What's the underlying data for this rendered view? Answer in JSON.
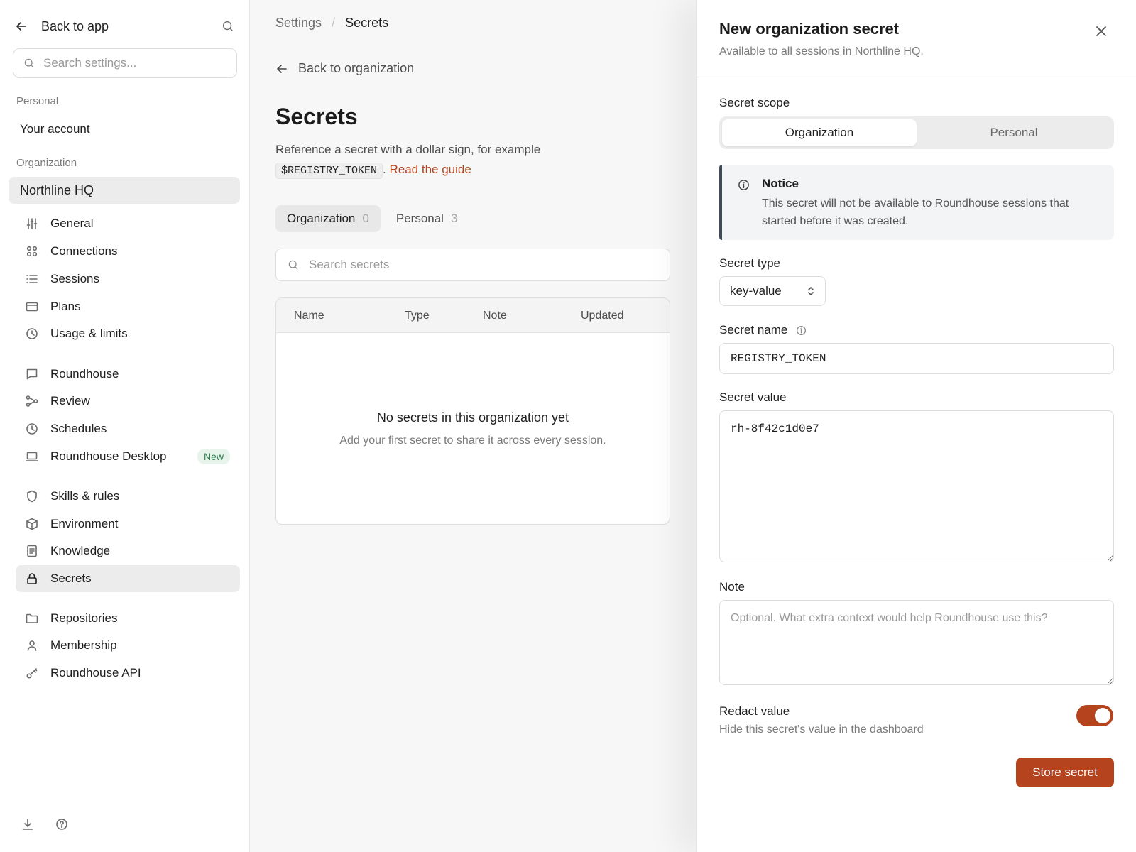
{
  "sidebar": {
    "back_label": "Back to app",
    "search_placeholder": "Search settings...",
    "personal_label": "Personal",
    "account_label": "Your account",
    "organization_label": "Organization",
    "org_name": "Northline HQ",
    "items": [
      {
        "label": "General",
        "icon": "sliders-icon"
      },
      {
        "label": "Connections",
        "icon": "grid-icon"
      },
      {
        "label": "Sessions",
        "icon": "list-icon"
      },
      {
        "label": "Plans",
        "icon": "card-icon"
      },
      {
        "label": "Usage & limits",
        "icon": "clock-icon"
      },
      {
        "label": "Roundhouse",
        "icon": "chat-icon"
      },
      {
        "label": "Review",
        "icon": "branch-icon"
      },
      {
        "label": "Schedules",
        "icon": "clock-icon"
      },
      {
        "label": "Roundhouse Desktop",
        "icon": "laptop-icon",
        "badge": "New"
      },
      {
        "label": "Skills & rules",
        "icon": "shield-icon"
      },
      {
        "label": "Environment",
        "icon": "cube-icon"
      },
      {
        "label": "Knowledge",
        "icon": "document-icon"
      },
      {
        "label": "Secrets",
        "icon": "lock-icon",
        "selected": true
      },
      {
        "label": "Repositories",
        "icon": "folder-icon"
      },
      {
        "label": "Membership",
        "icon": "user-icon"
      },
      {
        "label": "Roundhouse API",
        "icon": "key-icon"
      }
    ]
  },
  "main": {
    "breadcrumb": {
      "parent": "Settings",
      "separator": "/",
      "current": "Secrets"
    },
    "back_label": "Back to organization",
    "title": "Secrets",
    "description_prefix": "Reference a secret with a dollar sign, for example",
    "example_code": "$REGISTRY_TOKEN",
    "description_mid": ".",
    "guide_link": "Read the guide",
    "tabs": [
      {
        "label": "Organization",
        "count": "0",
        "active": true
      },
      {
        "label": "Personal",
        "count": "3",
        "active": false
      }
    ],
    "search_placeholder": "Search secrets",
    "table": {
      "columns": [
        "Name",
        "Type",
        "Note",
        "Updated"
      ],
      "empty_title": "No secrets in this organization yet",
      "empty_subtitle": "Add your first secret to share it across every session."
    }
  },
  "drawer": {
    "title": "New organization secret",
    "subtitle": "Available to all sessions in Northline HQ.",
    "scope_label": "Secret scope",
    "scope_options": [
      "Organization",
      "Personal"
    ],
    "scope_selected": "Organization",
    "notice_title": "Notice",
    "notice_body": "This secret will not be available to Roundhouse sessions that started before it was created.",
    "type_label": "Secret type",
    "type_value": "key-value",
    "name_label": "Secret name",
    "name_value": "REGISTRY_TOKEN",
    "value_label": "Secret value",
    "value_value": "rh-8f42c1d0e7",
    "note_label": "Note",
    "note_placeholder": "Optional. What extra context would help Roundhouse use this?",
    "redact_title": "Redact value",
    "redact_subtitle": "Hide this secret's value in the dashboard",
    "redact_on": true,
    "submit_label": "Store secret"
  },
  "colors": {
    "accent": "#b5441e",
    "badge_green": "#2e7d4f"
  }
}
